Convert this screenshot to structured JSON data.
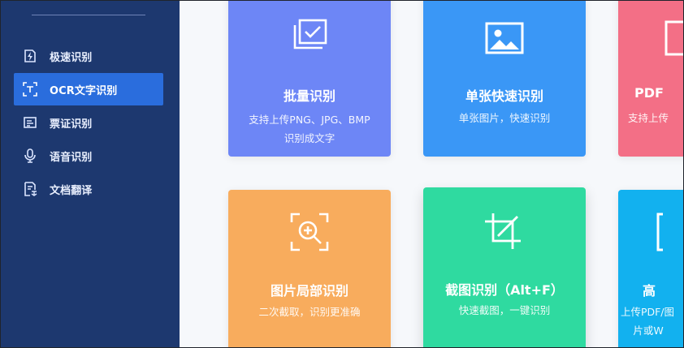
{
  "sidebar": {
    "items": [
      {
        "label": "极速识别",
        "icon": "lightning-doc-icon",
        "active": false
      },
      {
        "label": "OCR文字识别",
        "icon": "text-scan-icon",
        "active": true
      },
      {
        "label": "票证识别",
        "icon": "ticket-icon",
        "active": false
      },
      {
        "label": "语音识别",
        "icon": "microphone-icon",
        "active": false
      },
      {
        "label": "文档翻译",
        "icon": "doc-translate-icon",
        "active": false
      }
    ]
  },
  "cards": [
    {
      "title": "批量识别",
      "desc1": "支持上传PNG、JPG、BMP",
      "desc2": "识别成文字",
      "color": "#6d86f6",
      "icon": "batch-check-icon"
    },
    {
      "title": "单张快速识别",
      "desc1": "单张图片，快速识别",
      "color": "#3a97f6",
      "icon": "image-icon"
    },
    {
      "title": "PDF",
      "desc1": "支持上传",
      "color": "#f36f86",
      "icon": "pdf-doc-icon"
    },
    {
      "title": "图片局部识别",
      "desc1": "二次截取，识别更准确",
      "color": "#f8ac5d",
      "icon": "zoom-scan-icon"
    },
    {
      "title": "截图识别（Alt+F）",
      "desc1": "快速截图，一键识别",
      "color": "#2fdaa0",
      "icon": "crop-icon"
    },
    {
      "title": "高",
      "desc1": "上传PDF/图",
      "desc2": "片或W",
      "color": "#12b1ef",
      "icon": "scan-bracket-icon"
    }
  ]
}
